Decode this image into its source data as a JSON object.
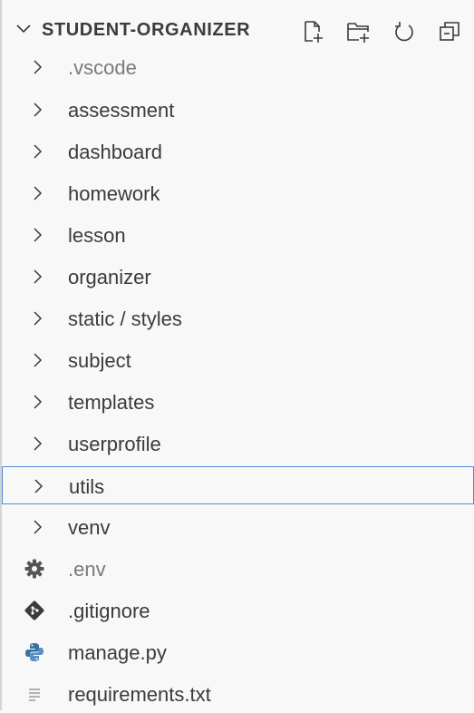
{
  "explorer": {
    "title": "STUDENT-ORGANIZER",
    "actions": [
      {
        "name": "new-file-icon"
      },
      {
        "name": "new-folder-icon"
      },
      {
        "name": "refresh-icon"
      },
      {
        "name": "collapse-all-icon"
      }
    ],
    "folders": [
      {
        "label": ".vscode",
        "dim": true
      },
      {
        "label": "assessment"
      },
      {
        "label": "dashboard"
      },
      {
        "label": "homework"
      },
      {
        "label": "lesson"
      },
      {
        "label": "organizer"
      },
      {
        "label": "static / styles"
      },
      {
        "label": "subject"
      },
      {
        "label": "templates"
      },
      {
        "label": "userprofile"
      },
      {
        "label": "utils",
        "selected": true
      },
      {
        "label": "venv"
      }
    ],
    "files": [
      {
        "label": ".env",
        "icon": "gear-icon",
        "dim": true
      },
      {
        "label": ".gitignore",
        "icon": "git-icon"
      },
      {
        "label": "manage.py",
        "icon": "python-icon"
      },
      {
        "label": "requirements.txt",
        "icon": "text-file-icon"
      }
    ]
  },
  "colors": {
    "background": "#f8f8f8",
    "text": "#3b3b3b",
    "dim_text": "#7a7a7a",
    "selection_border": "#4a8fd6",
    "python_blue": "#3572A5"
  }
}
